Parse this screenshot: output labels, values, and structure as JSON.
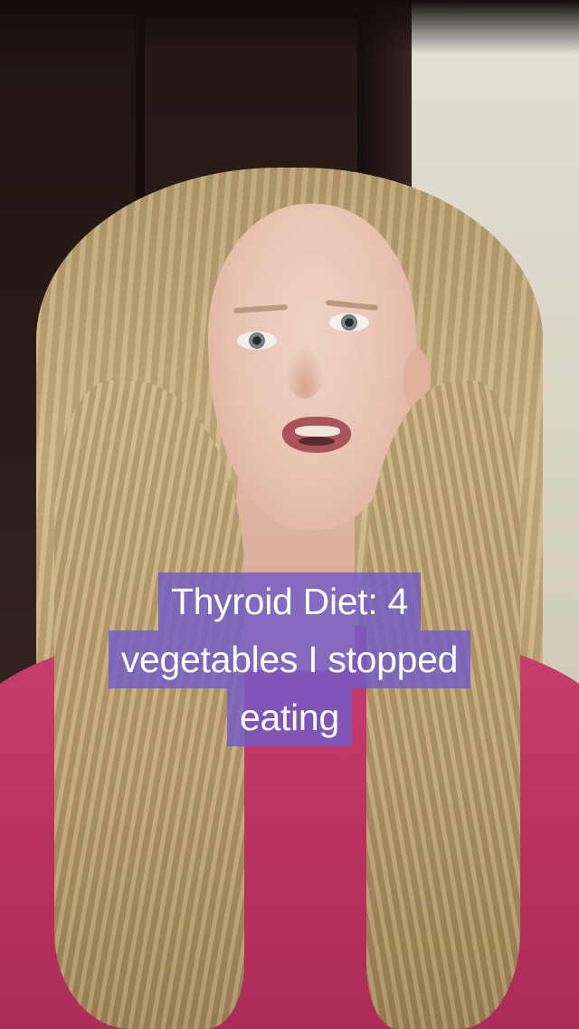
{
  "caption": {
    "lines": [
      "Thyroid Diet: 4",
      "vegetables I stopped",
      "eating"
    ]
  },
  "colors": {
    "caption_background": "#705CC8",
    "caption_text": "#FFFFFF",
    "shirt": "#B9325F",
    "wall": "#D8D4C6",
    "door": "#2A1D19"
  }
}
